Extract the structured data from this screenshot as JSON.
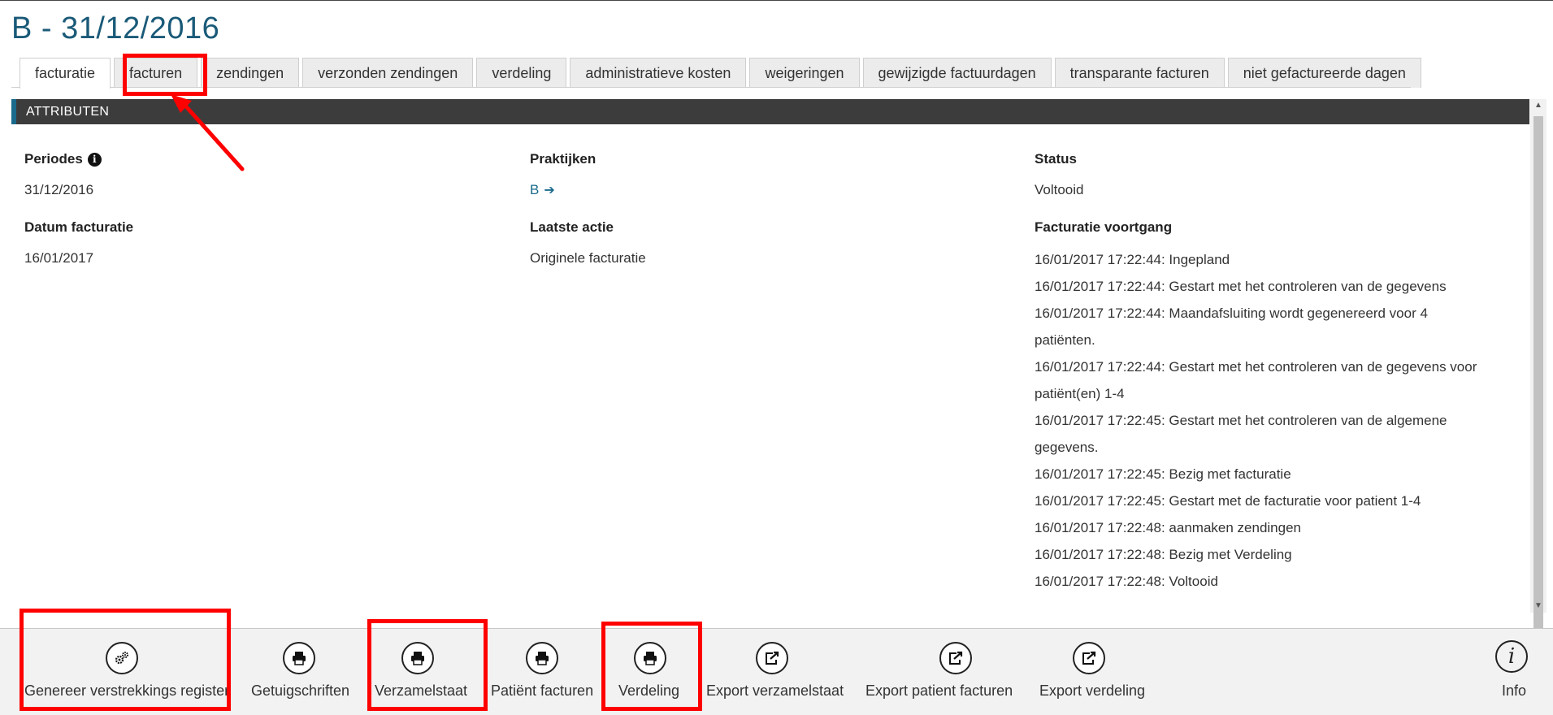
{
  "page": {
    "title": "B - 31/12/2016"
  },
  "tabs": [
    {
      "label": "facturatie",
      "active": true
    },
    {
      "label": "facturen"
    },
    {
      "label": "zendingen"
    },
    {
      "label": "verzonden zendingen"
    },
    {
      "label": "verdeling"
    },
    {
      "label": "administratieve kosten"
    },
    {
      "label": "weigeringen"
    },
    {
      "label": "gewijzigde factuurdagen"
    },
    {
      "label": "transparante facturen"
    },
    {
      "label": "niet gefactureerde dagen"
    }
  ],
  "section": {
    "header": "ATTRIBUTEN"
  },
  "fields": {
    "periodes": {
      "label": "Periodes",
      "value": "31/12/2016"
    },
    "praktijken": {
      "label": "Praktijken",
      "value": "B"
    },
    "status": {
      "label": "Status",
      "value": "Voltooid"
    },
    "datum_facturatie": {
      "label": "Datum facturatie",
      "value": "16/01/2017"
    },
    "laatste_actie": {
      "label": "Laatste actie",
      "value": "Originele facturatie"
    },
    "voortgang": {
      "label": "Facturatie voortgang"
    }
  },
  "progress": [
    "16/01/2017 17:22:44: Ingepland",
    "16/01/2017 17:22:44: Gestart met het controleren van de gegevens",
    "16/01/2017 17:22:44: Maandafsluiting wordt gegenereerd voor 4",
    "patiënten.",
    "16/01/2017 17:22:44: Gestart met het controleren van de gegevens voor",
    "patiënt(en) 1-4",
    "16/01/2017 17:22:45: Gestart met het controleren van de algemene",
    "gegevens.",
    "16/01/2017 17:22:45: Bezig met facturatie",
    "16/01/2017 17:22:45: Gestart met de facturatie voor patient 1-4",
    "16/01/2017 17:22:48: aanmaken zendingen",
    "16/01/2017 17:22:48: Bezig met Verdeling",
    "16/01/2017 17:22:48: Voltooid"
  ],
  "toolbar": {
    "genereer": {
      "label": "Genereer verstrekkings register",
      "icon": "gears-icon"
    },
    "getuigschriften": {
      "label": "Getuigschriften",
      "icon": "printer-icon"
    },
    "verzamelstaat": {
      "label": "Verzamelstaat",
      "icon": "printer-icon"
    },
    "patient_facturen": {
      "label": "Patiënt facturen",
      "icon": "printer-icon"
    },
    "verdeling": {
      "label": "Verdeling",
      "icon": "printer-icon"
    },
    "export_verzamelstaat": {
      "label": "Export verzamelstaat",
      "icon": "export-icon"
    },
    "export_patient_facturen": {
      "label": "Export patient facturen",
      "icon": "export-icon"
    },
    "export_verdeling": {
      "label": "Export verdeling",
      "icon": "export-icon"
    },
    "info": {
      "label": "Info",
      "icon": "info-icon"
    }
  },
  "colors": {
    "title": "#1a5a78",
    "accent": "#1a6a8c",
    "header_bg": "#3c3c3c",
    "annotation": "#ff0000"
  }
}
